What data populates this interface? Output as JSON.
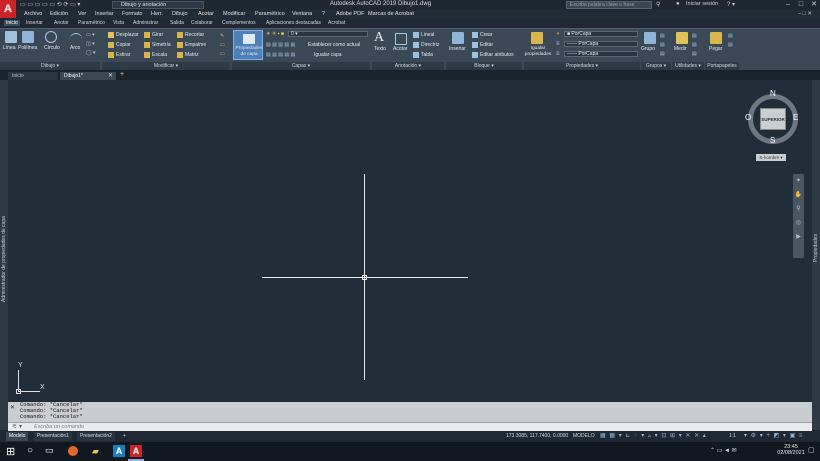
{
  "titlebar": {
    "logo": "A",
    "workspace": "Dibujo y anotación",
    "app_title": "Autodesk AutoCAD 2019   Dibujo1.dwg",
    "search_placeholder": "Escriba palabra clave o frase",
    "sign_in": "Iniciar sesión"
  },
  "menu": [
    "Archivo",
    "Edición",
    "Ver",
    "Insertar",
    "Formato",
    "Herr.",
    "Dibujo",
    "Acotar",
    "Modificar",
    "Paramétrico",
    "Ventana",
    "?",
    "Adobe PDF",
    "Marcas de Acrobat"
  ],
  "ribbon_tabs": [
    "Inicio",
    "Insertar",
    "Anotar",
    "Paramétrico",
    "Vista",
    "Administrar",
    "Salida",
    "Colaborar",
    "Complementos",
    "Aplicaciones destacadas",
    "Acrobat"
  ],
  "ribbon": {
    "draw": {
      "line": "Línea",
      "polyline": "Polilínea",
      "circle": "Círculo",
      "arc": "Arco",
      "label": "Dibujo ▾"
    },
    "modify": {
      "move": "Desplazar",
      "rotate": "Girar",
      "trim": "Recortar",
      "copy": "Copiar",
      "mirror": "Simetría",
      "fillet": "Empalme",
      "stretch": "Estirar",
      "scale": "Escala",
      "array": "Matriz",
      "label": "Modificar ▾"
    },
    "layers": {
      "properties": "Propiedades de capa",
      "layer_value": "0",
      "make_current": "Establecer como actual",
      "match_layer": "Igualar capa",
      "label": "Capas ▾"
    },
    "annotation": {
      "text": "Texto",
      "dimension": "Acotar",
      "linear": "Lineal",
      "leader": "Directriz",
      "table": "Tabla",
      "label": "Anotación ▾"
    },
    "block": {
      "insert": "Insertar",
      "create": "Crear",
      "edit": "Editar",
      "edit_attributes": "Editar atributos",
      "label": "Bloque ▾"
    },
    "properties": {
      "match": "Igualar propiedades",
      "color": "PorCapa",
      "linetype": "PorCapa",
      "lineweight": "PorCapa",
      "label": "Propiedades ▾"
    },
    "groups": {
      "group": "Grupo",
      "label": "Grupos ▾"
    },
    "utilities": {
      "measure": "Medir",
      "label": "Utilidades ▾"
    },
    "clipboard": {
      "paste": "Pegar",
      "label": "Portapapeles"
    }
  },
  "doc_tabs": [
    "Inicio",
    "Dibujo1*"
  ],
  "left_panel": "Administrador de propiedades de capa",
  "right_panel": "Propiedades",
  "viewcube": {
    "n": "N",
    "s": "S",
    "e": "E",
    "o": "O",
    "face": "SUPERIOR",
    "wcs": "S-hombre ▾"
  },
  "ucs": {
    "x": "X",
    "y": "Y"
  },
  "command_history": [
    "Comando: *Cancelar*",
    "Comando: *Cancelar*",
    "Comando: *Cancelar*"
  ],
  "command_placeholder": "Escriba un comando",
  "layout_tabs": [
    "Modelo",
    "Presentación1",
    "Presentación2",
    "+"
  ],
  "status": {
    "coords": "173.3085, 117.7400, 0.0000",
    "mode": "MODELO",
    "scale": "1:1"
  },
  "taskbar": {
    "time": "23:45",
    "date": "02/08/2021"
  },
  "colors": {
    "canvas": "#212d38",
    "accent": "#c8262c"
  }
}
